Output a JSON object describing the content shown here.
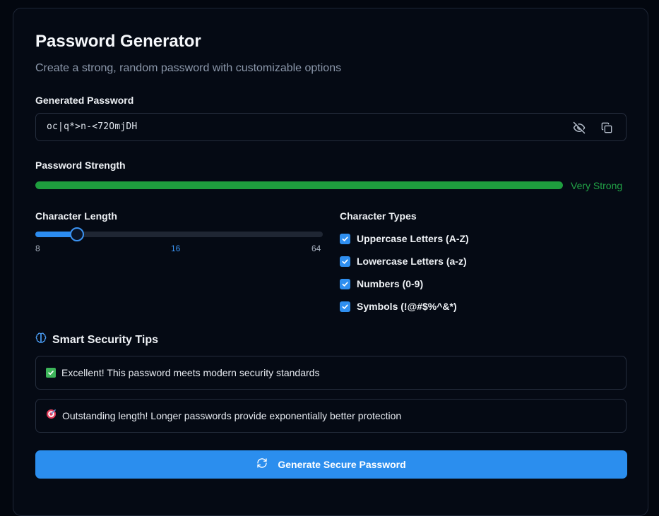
{
  "header": {
    "title": "Password Generator",
    "subtitle": "Create a strong, random password with customizable options"
  },
  "password": {
    "label": "Generated Password",
    "value": "oc|q*>n-<72OmjDH",
    "toggle_icon": "eye-off-icon",
    "copy_icon": "copy-icon"
  },
  "strength": {
    "label": "Password Strength",
    "text": "Very Strong",
    "level_percent": 100,
    "color": "#1e9e3e"
  },
  "length": {
    "label": "Character Length",
    "min": "8",
    "current": "16",
    "max": "64",
    "min_value": 8,
    "max_value": 64,
    "value": 16,
    "accent": "#2c8cf0"
  },
  "types": {
    "label": "Character Types",
    "options": [
      {
        "label": "Uppercase Letters (A-Z)",
        "checked": true
      },
      {
        "label": "Lowercase Letters (a-z)",
        "checked": true
      },
      {
        "label": "Numbers (0-9)",
        "checked": true
      },
      {
        "label": "Symbols (!@#$%^&*)",
        "checked": true
      }
    ]
  },
  "tips": {
    "title": "Smart Security Tips",
    "icon": "brain-icon",
    "items": [
      {
        "icon": "check-mark-emoji-icon",
        "text": "Excellent! This password meets modern security standards"
      },
      {
        "icon": "target-emoji-icon",
        "text": "Outstanding length! Longer passwords provide exponentially better protection"
      }
    ]
  },
  "generate": {
    "label": "Generate Secure Password",
    "icon": "refresh-icon",
    "color": "#2b8eee"
  }
}
